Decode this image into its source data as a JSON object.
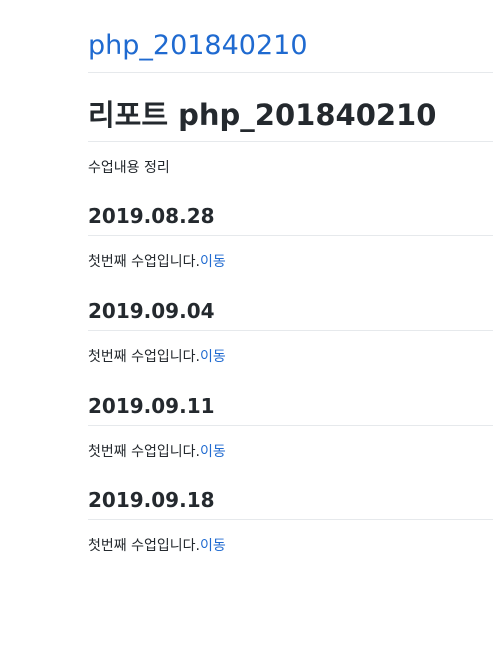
{
  "site": {
    "title": "php_201840210"
  },
  "page": {
    "title": "리포트 php_201840210",
    "intro": "수업내용 정리"
  },
  "sections": [
    {
      "date": "2019.08.28",
      "text": "첫번째 수업입니다.",
      "link": "이동"
    },
    {
      "date": "2019.09.04",
      "text": "첫번째 수업입니다.",
      "link": "이동"
    },
    {
      "date": "2019.09.11",
      "text": "첫번째 수업입니다.",
      "link": "이동"
    },
    {
      "date": "2019.09.18",
      "text": "첫번째 수업입니다.",
      "link": "이동"
    }
  ],
  "colors": {
    "link": "#1f6ad0",
    "text": "#24292e",
    "rule": "#e6e9ec"
  }
}
